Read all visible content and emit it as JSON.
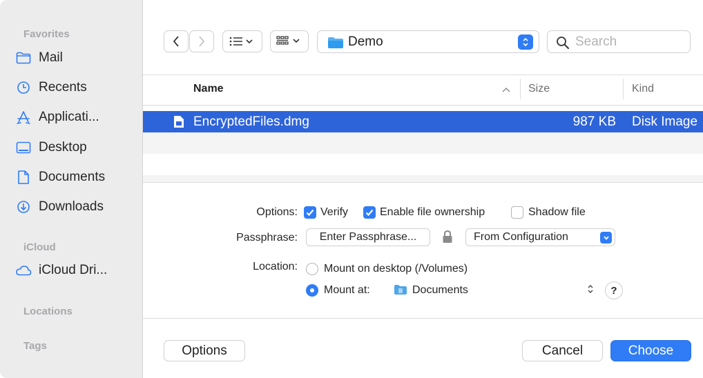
{
  "sidebar": {
    "sections": {
      "favorites": "Favorites",
      "icloud": "iCloud",
      "locations": "Locations",
      "tags": "Tags"
    },
    "items": [
      {
        "label": "Mail",
        "icon": "folder-icon"
      },
      {
        "label": "Recents",
        "icon": "clock-icon"
      },
      {
        "label": "Applicati...",
        "icon": "applications-icon"
      },
      {
        "label": "Desktop",
        "icon": "desktop-icon"
      },
      {
        "label": "Documents",
        "icon": "document-icon"
      },
      {
        "label": "Downloads",
        "icon": "download-icon"
      },
      {
        "label": "iCloud Dri...",
        "icon": "cloud-icon"
      }
    ]
  },
  "toolbar": {
    "location": "Demo",
    "search_placeholder": "Search"
  },
  "table": {
    "columns": [
      "Name",
      "Size",
      "Kind"
    ],
    "rows": [
      {
        "name": "EncryptedFiles.dmg",
        "size": "987 KB",
        "kind": "Disk Image",
        "selected": true
      }
    ]
  },
  "options": {
    "options_label": "Options:",
    "verify": {
      "label": "Verify",
      "checked": true
    },
    "ownership": {
      "label": "Enable file ownership",
      "checked": true
    },
    "shadow": {
      "label": "Shadow file",
      "checked": false
    },
    "passphrase_label": "Passphrase:",
    "passphrase_button": "Enter Passphrase...",
    "passphrase_source": "From Configuration",
    "location_label": "Location:",
    "mount_desktop": {
      "label": "Mount on desktop (/Volumes)",
      "selected": false
    },
    "mount_at": {
      "label": "Mount at:",
      "selected": true,
      "folder": "Documents"
    },
    "help": "?"
  },
  "buttons": {
    "options": "Options",
    "cancel": "Cancel",
    "choose": "Choose"
  },
  "colors": {
    "accent": "#2f7cf6",
    "selection": "#2e64d9"
  }
}
